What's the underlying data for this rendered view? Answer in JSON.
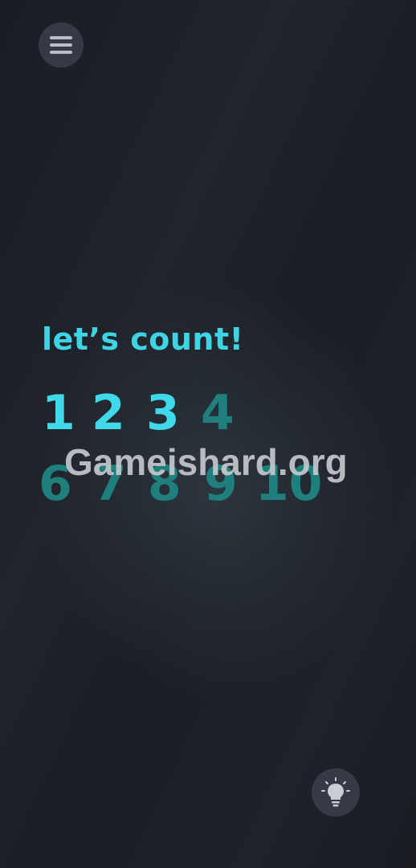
{
  "header": {
    "menu_icon": "hamburger-menu-icon"
  },
  "main": {
    "title": "let’s count!",
    "numbers": [
      "1",
      "2",
      "3",
      "4",
      "6",
      "7",
      "8",
      "9",
      "10"
    ],
    "revealed_count": 3
  },
  "watermark": "Gameishard.org",
  "footer": {
    "hint_icon": "lightbulb-icon"
  },
  "colors": {
    "background": "#1c1f26",
    "accent": "#3fd9ea",
    "dim_number": "#1e7f7d",
    "button_bg": "#353a44"
  }
}
